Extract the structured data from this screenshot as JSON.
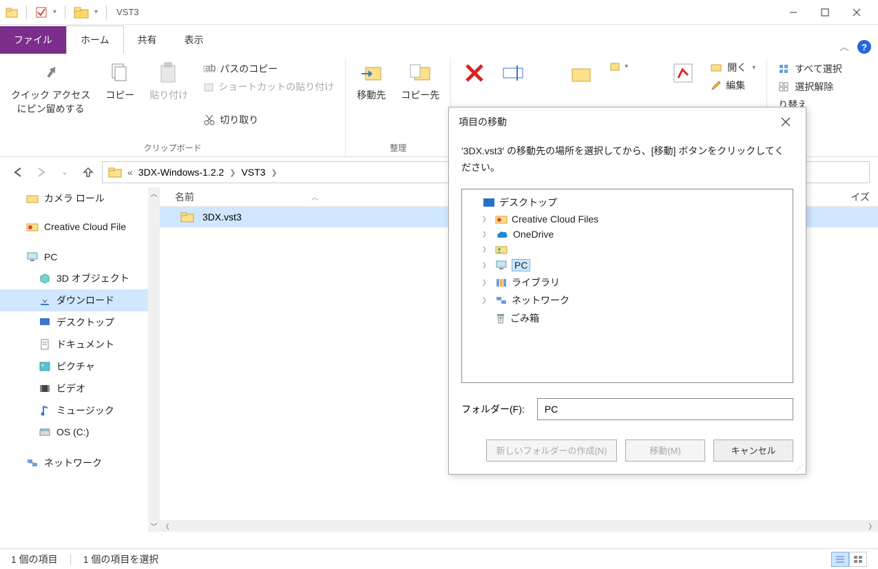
{
  "window": {
    "title": "VST3"
  },
  "tabs": {
    "file": "ファイル",
    "home": "ホーム",
    "share": "共有",
    "view": "表示"
  },
  "ribbon": {
    "quick_access_pin": "クイック アクセス\nにピン留めする",
    "copy": "コピー",
    "paste": "貼り付け",
    "copy_path": "パスのコピー",
    "paste_shortcut": "ショートカットの貼り付け",
    "cut": "切り取り",
    "clipboard_group": "クリップボード",
    "move_to": "移動先",
    "copy_to": "コピー先",
    "organize_group": "整理",
    "open": "開く",
    "edit": "編集",
    "select_all": "すべて選択",
    "select_none": "選択解除",
    "invert": "り替え"
  },
  "breadcrumb": {
    "prefix": "«",
    "p1": "3DX-Windows-1.2.2",
    "p2": "VST3"
  },
  "columns": {
    "name": "名前",
    "size_suffix": "イズ"
  },
  "sidebar": {
    "camera_roll": "カメラ ロール",
    "ccf": "Creative Cloud File",
    "pc": "PC",
    "objects3d": "3D オブジェクト",
    "downloads": "ダウンロード",
    "desktop": "デスクトップ",
    "documents": "ドキュメント",
    "pictures": "ピクチャ",
    "videos": "ビデオ",
    "music": "ミュージック",
    "osc": "OS (C:)",
    "network": "ネットワーク"
  },
  "file": {
    "name": "3DX.vst3"
  },
  "status": {
    "count": "1 個の項目",
    "selected": "1 個の項目を選択"
  },
  "dialog": {
    "title": "項目の移動",
    "message": "'3DX.vst3' の移動先の場所を選択してから、[移動] ボタンをクリックしてください。",
    "tree": {
      "desktop": "デスクトップ",
      "ccf": "Creative Cloud Files",
      "onedrive": "OneDrive",
      "pc": "PC",
      "libraries": "ライブラリ",
      "network": "ネットワーク",
      "recycle": "ごみ箱"
    },
    "folder_label": "フォルダー(F):",
    "folder_value": "PC",
    "new_folder": "新しいフォルダーの作成(N)",
    "move": "移動(M)",
    "cancel": "キャンセル"
  }
}
